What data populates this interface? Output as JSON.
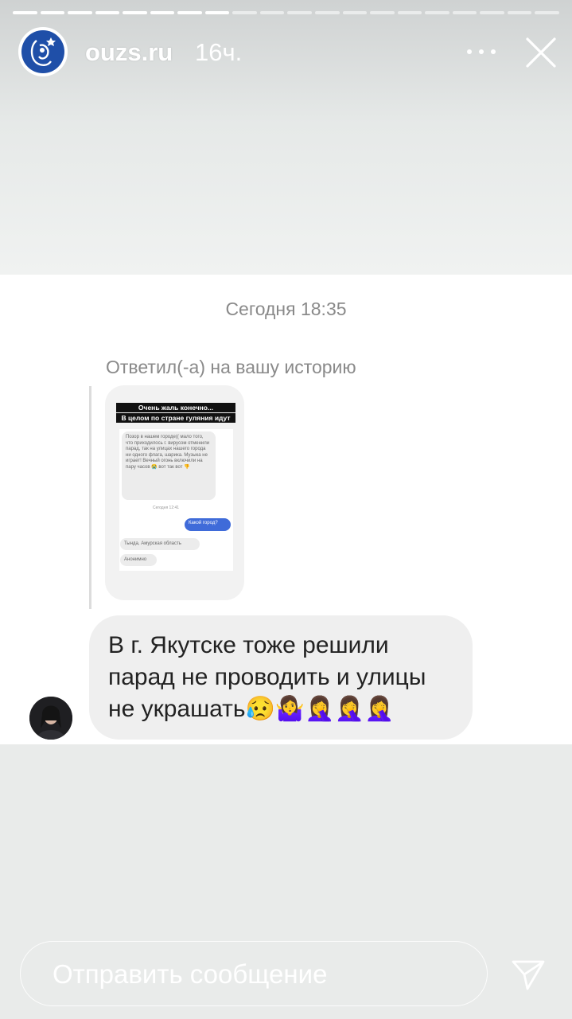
{
  "story": {
    "account": "ouzs.ru",
    "age": "16ч.",
    "segments_total": 20,
    "segments_done": 8
  },
  "chat": {
    "date": "Сегодня 18:35",
    "reply_note": "Ответил(-а) на вашу историю",
    "message_lines": [
      "В г. Якутске тоже решили",
      "парад не проводить и улицы",
      "не украшать😥🤷‍♀️🤦‍♀️🤦‍♀️🤦‍♀️"
    ]
  },
  "thumbnail": {
    "caption_1": "Очень жаль конечно...",
    "caption_2": "В целом по стране гуляния идут",
    "msg_1": "Позор в нашем городе(( мало того, что приходилось г. вирусом отменили парад, так на улицах нашего города ни одного флага, шарика. Музыка не играет! Вечный огонь включили на пару часов 😭 вот так вот 👎",
    "date": "Сегодня 12:41",
    "msg_question": "Какой город?",
    "msg_answer_1": "Тында, Амурская область",
    "msg_answer_2": "Анонимно"
  },
  "reply": {
    "placeholder": "Отправить сообщение"
  },
  "icons": {
    "more": "more-dots-icon",
    "close": "close-icon",
    "send": "send-icon",
    "avatar": "brand-logo-icon"
  },
  "colors": {
    "brand_blue": "#1f4fa8",
    "bubble": "#efefef",
    "accent_blue": "#3f6bd9"
  }
}
